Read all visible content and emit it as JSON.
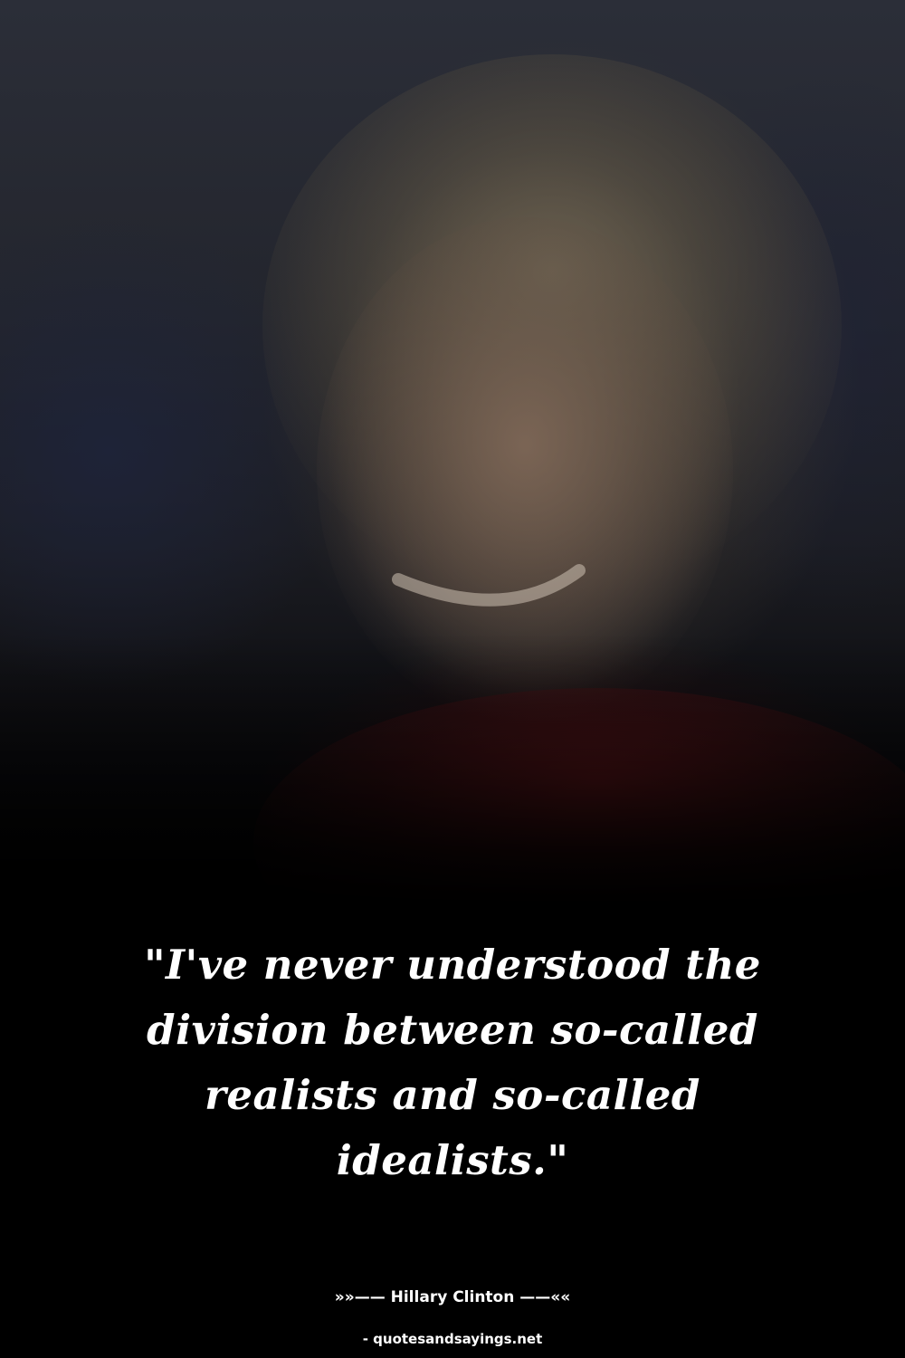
{
  "quote": {
    "text": "\"I've never understood the division between so-called realists and so-called idealists.\""
  },
  "author": {
    "line": "»»—— Hillary Clinton ——««"
  },
  "source": {
    "line": "- quotesandsayings.net"
  }
}
